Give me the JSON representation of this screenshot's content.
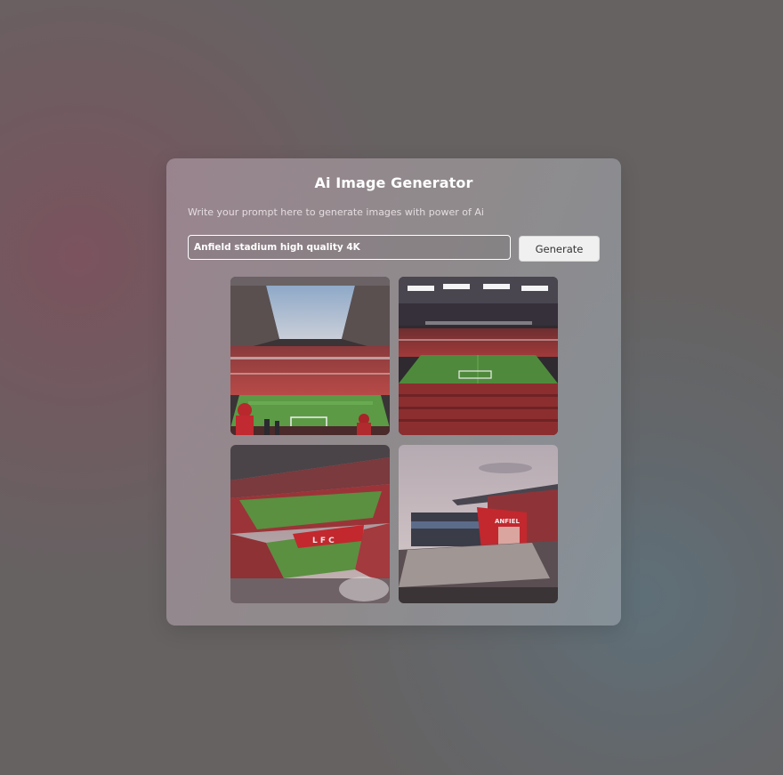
{
  "app": {
    "title": "Ai Image Generator",
    "subtitle": "Write your prompt here to generate images with power of Ai"
  },
  "form": {
    "prompt_value": "Anfield stadium high quality 4K",
    "generate_label": "Generate"
  },
  "gallery": {
    "images": [
      {
        "subject": "stadium interior with open roof and players"
      },
      {
        "subject": "stadium interior at night with floodlights"
      },
      {
        "subject": "aerial stadium view with red stands"
      },
      {
        "subject": "stadium exterior with red facade"
      }
    ]
  },
  "colors": {
    "background": "#666262",
    "card": "#948c90",
    "accent_red": "#b32a30",
    "pitch_green": "#4f8a3c"
  }
}
